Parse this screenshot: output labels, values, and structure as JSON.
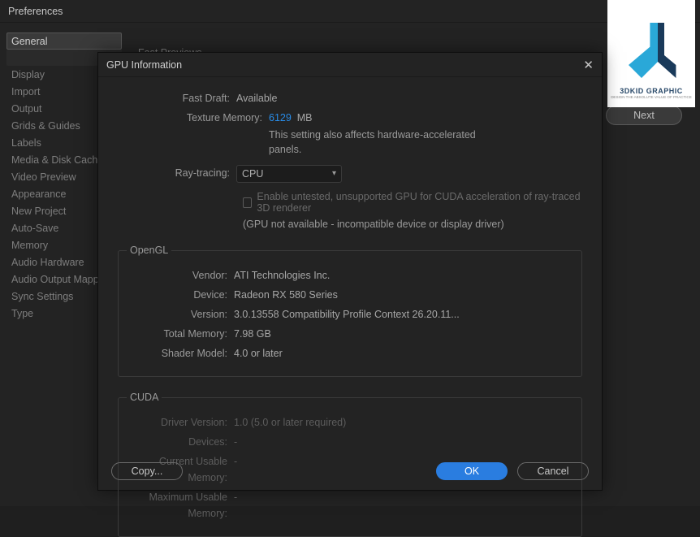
{
  "prefs": {
    "title": "Preferences",
    "sidebar": [
      "General",
      "",
      "Display",
      "Import",
      "Output",
      "Grids & Guides",
      "Labels",
      "Media & Disk Cache",
      "Video Preview",
      "Appearance",
      "New Project",
      "Auto-Save",
      "Memory",
      "Audio Hardware",
      "Audio Output Mapping",
      "Sync Settings",
      "Type"
    ],
    "main_heading": "Fast Previews",
    "next_label": "Next"
  },
  "dlg": {
    "title": "GPU Information",
    "fast_draft_label": "Fast Draft:",
    "fast_draft_value": "Available",
    "texture_mem_label": "Texture Memory:",
    "texture_mem_value": "6129",
    "texture_mem_unit": "MB",
    "texture_note": "This setting also affects hardware-accelerated panels.",
    "ray_label": "Ray-tracing:",
    "ray_value": "CPU",
    "cb_label": "Enable untested, unsupported GPU for CUDA acceleration of ray-traced 3D renderer",
    "paren": "(GPU not available - incompatible device or display driver)",
    "opengl": {
      "legend": "OpenGL",
      "rows": [
        {
          "label": "Vendor:",
          "value": "ATI Technologies Inc."
        },
        {
          "label": "Device:",
          "value": "Radeon RX 580 Series"
        },
        {
          "label": "Version:",
          "value": "3.0.13558 Compatibility Profile Context 26.20.11..."
        },
        {
          "label": "Total Memory:",
          "value": "7.98 GB"
        },
        {
          "label": "Shader Model:",
          "value": "4.0 or later"
        }
      ]
    },
    "cuda": {
      "legend": "CUDA",
      "rows": [
        {
          "label": "Driver Version:",
          "value": "1.0 (5.0 or later required)"
        },
        {
          "label": "Devices:",
          "value": "-"
        },
        {
          "label": "Current Usable Memory:",
          "value": "-"
        },
        {
          "label": "Maximum Usable Memory:",
          "value": "-"
        }
      ]
    },
    "copy_label": "Copy...",
    "ok_label": "OK",
    "cancel_label": "Cancel"
  },
  "logo": {
    "text": "3DKID GRAPHIC",
    "sub": "DESIGN THE ABSOLUTE VALUE OF PRACTICE"
  }
}
